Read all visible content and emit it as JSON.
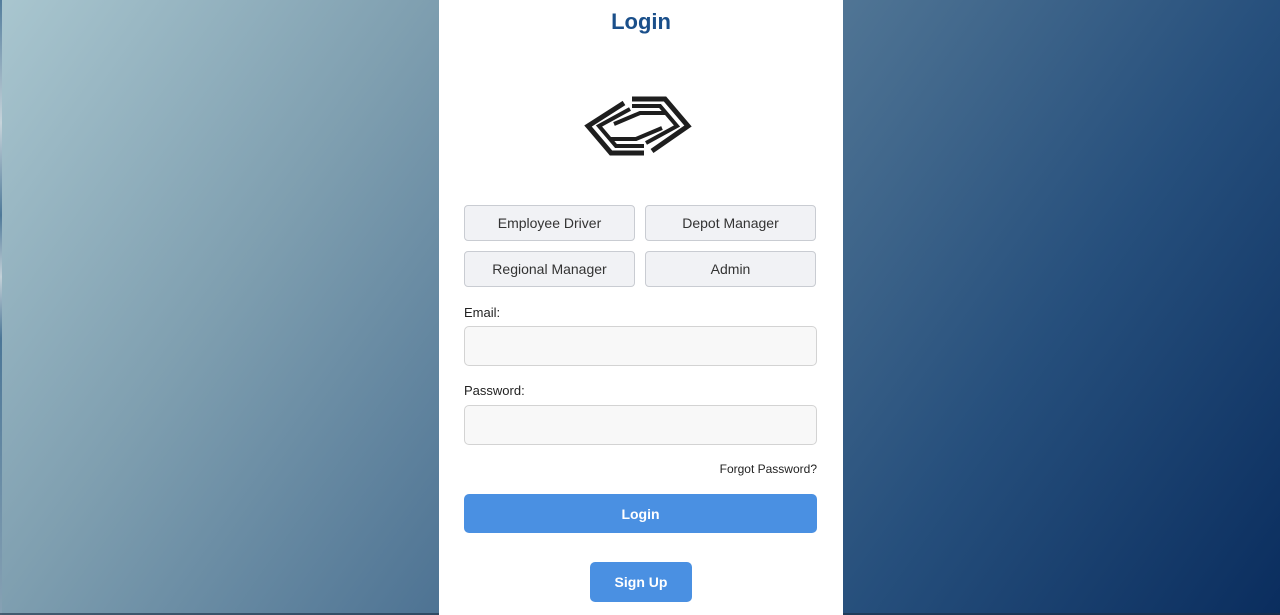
{
  "login_card": {
    "title": "Login",
    "logo_icon": "double-arrow-logo-icon",
    "roles": [
      {
        "label": "Employee Driver"
      },
      {
        "label": "Depot Manager"
      },
      {
        "label": "Regional Manager"
      },
      {
        "label": "Admin"
      }
    ],
    "email": {
      "label": "Email:",
      "value": "",
      "placeholder": ""
    },
    "password": {
      "label": "Password:",
      "value": "",
      "placeholder": ""
    },
    "forgot_password_label": "Forgot Password?",
    "login_button_label": "Login",
    "signup_button_label": "Sign Up"
  },
  "colors": {
    "primary": "#4a90e2",
    "title": "#1a4f8a",
    "background_start": "#a9c6cf",
    "background_end": "#0a2d5e"
  }
}
